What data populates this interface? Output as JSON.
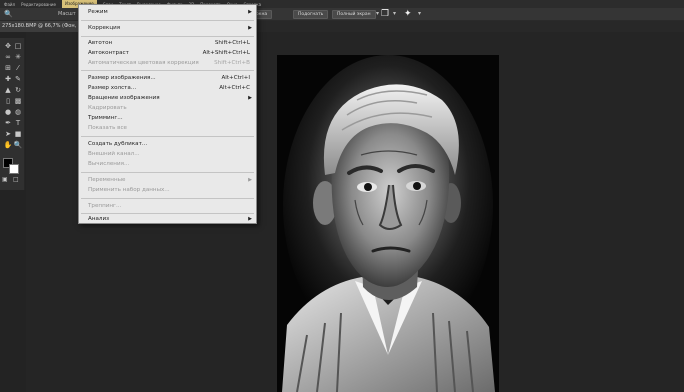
{
  "menubar": {
    "items": [
      "Файл",
      "Редактирование",
      "Изображение",
      "Слои",
      "Текст",
      "Выделение",
      "Фильтр",
      "3D",
      "Просмотр",
      "Окно",
      "Справка"
    ],
    "active_index": 2
  },
  "options": {
    "label": "Масшт",
    "buttons": [
      "В размер окна",
      "Подогнать",
      "Полный экран"
    ]
  },
  "document": {
    "tab_title": "275x180.BMP @ 66,7% (Фон, RGB/8)"
  },
  "dropdown": {
    "items": [
      {
        "label": "Режим",
        "shortcut": "",
        "submenu": true,
        "disabled": false
      },
      {
        "label": "Коррекция",
        "shortcut": "",
        "submenu": true,
        "disabled": false
      },
      {
        "label": "Автотон",
        "shortcut": "Shift+Ctrl+L",
        "submenu": false,
        "disabled": false
      },
      {
        "label": "Автоконтраст",
        "shortcut": "Alt+Shift+Ctrl+L",
        "submenu": false,
        "disabled": false
      },
      {
        "label": "Автоматическая цветовая коррекция",
        "shortcut": "Shift+Ctrl+B",
        "submenu": false,
        "disabled": true
      },
      {
        "label": "Размер изображения...",
        "shortcut": "Alt+Ctrl+I",
        "submenu": false,
        "disabled": false
      },
      {
        "label": "Размер холста...",
        "shortcut": "Alt+Ctrl+C",
        "submenu": false,
        "disabled": false
      },
      {
        "label": "Вращение изображения",
        "shortcut": "",
        "submenu": true,
        "disabled": false
      },
      {
        "label": "Кадрировать",
        "shortcut": "",
        "submenu": false,
        "disabled": true
      },
      {
        "label": "Тримминг...",
        "shortcut": "",
        "submenu": false,
        "disabled": false
      },
      {
        "label": "Показать все",
        "shortcut": "",
        "submenu": false,
        "disabled": true
      },
      {
        "label": "Создать дубликат...",
        "shortcut": "",
        "submenu": false,
        "disabled": false
      },
      {
        "label": "Внешний канал...",
        "shortcut": "",
        "submenu": false,
        "disabled": true
      },
      {
        "label": "Вычисления...",
        "shortcut": "",
        "submenu": false,
        "disabled": true
      },
      {
        "label": "Переменные",
        "shortcut": "",
        "submenu": true,
        "disabled": true
      },
      {
        "label": "Применить набор данных...",
        "shortcut": "",
        "submenu": false,
        "disabled": true
      },
      {
        "label": "Треппинг...",
        "shortcut": "",
        "submenu": false,
        "disabled": true
      },
      {
        "label": "Анализ",
        "shortcut": "",
        "submenu": true,
        "disabled": false
      }
    ]
  },
  "colors": {
    "active_menu": "#d9c27a",
    "menu_bg": "#e9e9e9",
    "workspace": "#252525"
  }
}
